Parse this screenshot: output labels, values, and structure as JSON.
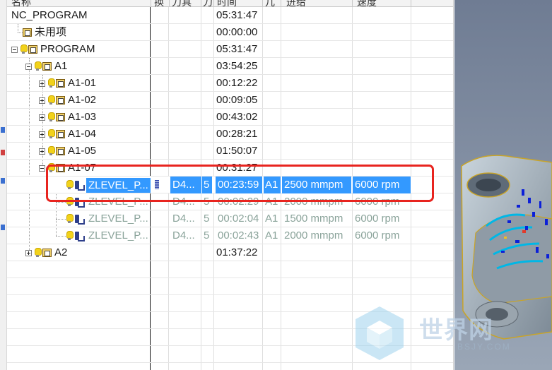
{
  "header": {
    "columns": [
      "名称",
      "换",
      "刀具",
      "刀",
      "时间",
      "几",
      "进给",
      "速度"
    ]
  },
  "tree": {
    "root": {
      "name": "NC_PROGRAM",
      "time": "05:31:47"
    },
    "unused": {
      "name": "未用项",
      "time": "00:00:00"
    },
    "program": {
      "name": "PROGRAM",
      "time": "05:31:47"
    },
    "a1": {
      "name": "A1",
      "time": "03:54:25"
    },
    "a1_01": {
      "name": "A1-01",
      "time": "00:12:22"
    },
    "a1_02": {
      "name": "A1-02",
      "time": "00:09:05"
    },
    "a1_03": {
      "name": "A1-03",
      "time": "00:43:02"
    },
    "a1_04": {
      "name": "A1-04",
      "time": "00:28:21"
    },
    "a1_05": {
      "name": "A1-05",
      "time": "01:50:07"
    },
    "a1_07": {
      "name": "A1-07",
      "time": "00:31:27"
    },
    "ops": [
      {
        "name": "ZLEVEL_P...",
        "tool": "D4...",
        "tool_no": "5",
        "time": "00:23:59",
        "geometry": "A1",
        "feed": "2500 mmpm",
        "speed": "6000 rpm"
      },
      {
        "name": "ZLEVEL_P...",
        "tool": "D4...",
        "tool_no": "5",
        "time": "00:02:29",
        "geometry": "A1",
        "feed": "2000 mmpm",
        "speed": "6000 rpm"
      },
      {
        "name": "ZLEVEL_P...",
        "tool": "D4...",
        "tool_no": "5",
        "time": "00:02:04",
        "geometry": "A1",
        "feed": "1500 mmpm",
        "speed": "6000 rpm"
      },
      {
        "name": "ZLEVEL_P...",
        "tool": "D4...",
        "tool_no": "5",
        "time": "00:02:43",
        "geometry": "A1",
        "feed": "2000 mmpm",
        "speed": "6000 rpm"
      }
    ],
    "a2": {
      "name": "A2",
      "time": "01:37:22"
    }
  },
  "colors": {
    "selection": "#3399ff",
    "annotation": "#e8241f",
    "inactive_text": "#8aa39a"
  },
  "watermark": {
    "text": "世界网",
    "sub": "BSJY.COM"
  }
}
